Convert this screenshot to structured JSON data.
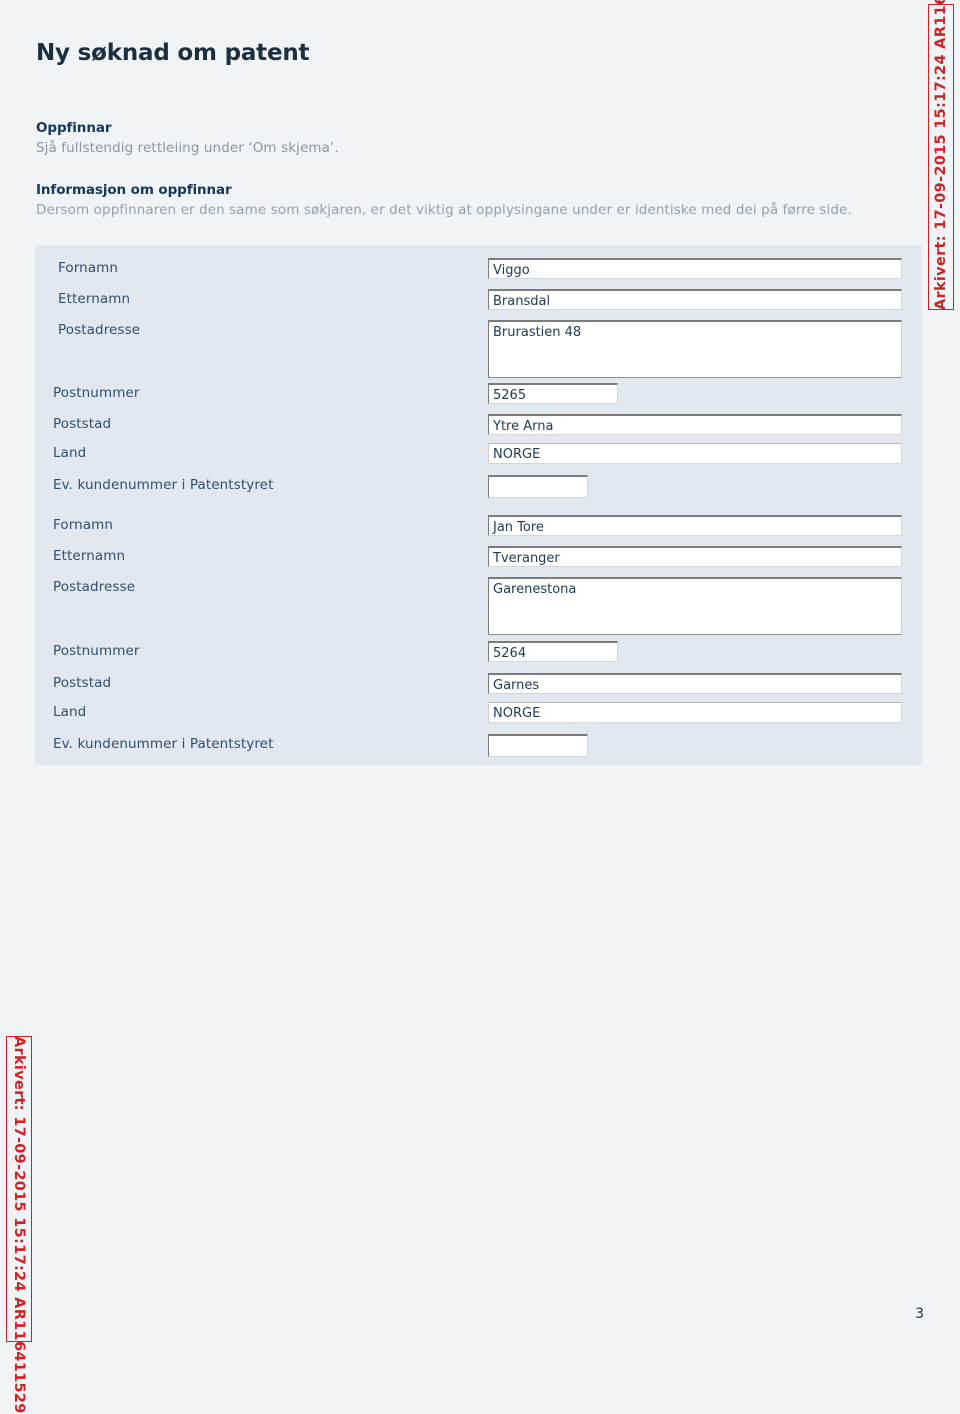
{
  "document": {
    "title": "Ny søknad om patent",
    "page_number": "3",
    "archive_stamp": "Arkivert: 17-09-2015 15:17:24 AR116411529",
    "stamp_color": "#cc2222",
    "background_color": "#f1f4f7",
    "panel_color": "#e2e8f0",
    "label_color": "#2f4f6f",
    "heading_color": "#1b2f3f"
  },
  "intro": [
    {
      "heading": "Oppfinnar",
      "text": "Sjå fullstendig rettleiing under ‘Om skjema’."
    },
    {
      "heading": "Informasjon om oppfinnar",
      "text": "Dersom oppfinnaren er den same som søkjaren, er det viktig at opplysingane under er identiske med dei på førre side."
    }
  ],
  "form": {
    "inventors": [
      {
        "fields": [
          {
            "label": "Fornamn",
            "value": "Viggo"
          },
          {
            "label": "Etternamn",
            "value": "Bransdal"
          },
          {
            "label": "Postadresse",
            "value": "Brurastien 48"
          },
          {
            "label": "Postnummer",
            "value": "5265"
          },
          {
            "label": "Poststad",
            "value": "Ytre Arna"
          },
          {
            "label": "Land",
            "value": "NORGE"
          },
          {
            "label": "Ev. kundenummer i Patentstyret",
            "value": ""
          }
        ]
      },
      {
        "fields": [
          {
            "label": "Fornamn",
            "value": "Jan Tore"
          },
          {
            "label": "Etternamn",
            "value": "Tveranger"
          },
          {
            "label": "Postadresse",
            "value": "Garenestona"
          },
          {
            "label": "Postnummer",
            "value": "5264"
          },
          {
            "label": "Poststad",
            "value": "Garnes"
          },
          {
            "label": "Land",
            "value": "NORGE"
          },
          {
            "label": "Ev. kundenummer i Patentstyret",
            "value": ""
          }
        ]
      }
    ]
  }
}
